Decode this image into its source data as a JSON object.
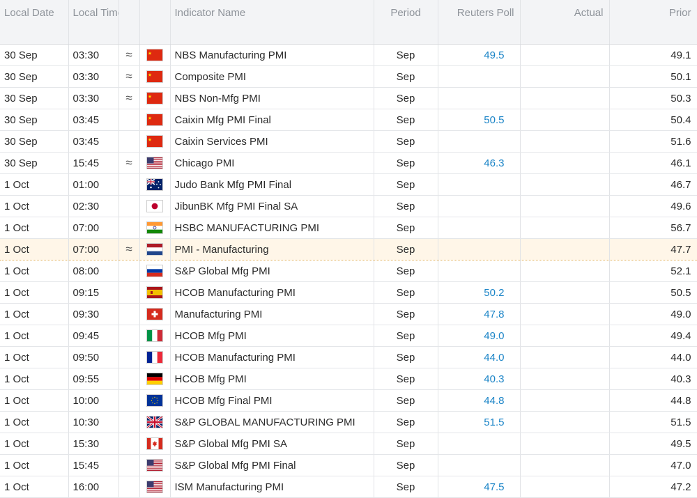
{
  "headers": {
    "local_date": "Local Date",
    "local_time": "Local Time",
    "indicator_name": "Indicator Name",
    "period": "Period",
    "reuters_poll": "Reuters Poll",
    "actual": "Actual",
    "prior": "Prior"
  },
  "rows": [
    {
      "date": "30 Sep",
      "time": "03:30",
      "approx": "≈",
      "flag": "cn",
      "name": "NBS Manufacturing PMI",
      "period": "Sep",
      "poll": "49.5",
      "actual": "",
      "prior": "49.1"
    },
    {
      "date": "30 Sep",
      "time": "03:30",
      "approx": "≈",
      "flag": "cn",
      "name": "Composite PMI",
      "period": "Sep",
      "poll": "",
      "actual": "",
      "prior": "50.1"
    },
    {
      "date": "30 Sep",
      "time": "03:30",
      "approx": "≈",
      "flag": "cn",
      "name": "NBS Non-Mfg PMI",
      "period": "Sep",
      "poll": "",
      "actual": "",
      "prior": "50.3"
    },
    {
      "date": "30 Sep",
      "time": "03:45",
      "approx": "",
      "flag": "cn",
      "name": "Caixin Mfg PMI Final",
      "period": "Sep",
      "poll": "50.5",
      "actual": "",
      "prior": "50.4"
    },
    {
      "date": "30 Sep",
      "time": "03:45",
      "approx": "",
      "flag": "cn",
      "name": "Caixin Services PMI",
      "period": "Sep",
      "poll": "",
      "actual": "",
      "prior": "51.6"
    },
    {
      "date": "30 Sep",
      "time": "15:45",
      "approx": "≈",
      "flag": "us",
      "name": "Chicago PMI",
      "period": "Sep",
      "poll": "46.3",
      "actual": "",
      "prior": "46.1"
    },
    {
      "date": "1 Oct",
      "time": "01:00",
      "approx": "",
      "flag": "au",
      "name": "Judo Bank Mfg PMI Final",
      "period": "Sep",
      "poll": "",
      "actual": "",
      "prior": "46.7"
    },
    {
      "date": "1 Oct",
      "time": "02:30",
      "approx": "",
      "flag": "jp",
      "name": "JibunBK Mfg PMI Final SA",
      "period": "Sep",
      "poll": "",
      "actual": "",
      "prior": "49.6"
    },
    {
      "date": "1 Oct",
      "time": "07:00",
      "approx": "",
      "flag": "in",
      "name": "HSBC MANUFACTURING PMI",
      "period": "Sep",
      "poll": "",
      "actual": "",
      "prior": "56.7"
    },
    {
      "date": "1 Oct",
      "time": "07:00",
      "approx": "≈",
      "flag": "nl",
      "name": "PMI - Manufacturing",
      "period": "Sep",
      "poll": "",
      "actual": "",
      "prior": "47.7",
      "highlight": true
    },
    {
      "date": "1 Oct",
      "time": "08:00",
      "approx": "",
      "flag": "ru",
      "name": "S&P Global Mfg PMI",
      "period": "Sep",
      "poll": "",
      "actual": "",
      "prior": "52.1"
    },
    {
      "date": "1 Oct",
      "time": "09:15",
      "approx": "",
      "flag": "es",
      "name": "HCOB Manufacturing PMI",
      "period": "Sep",
      "poll": "50.2",
      "actual": "",
      "prior": "50.5"
    },
    {
      "date": "1 Oct",
      "time": "09:30",
      "approx": "",
      "flag": "ch",
      "name": "Manufacturing PMI",
      "period": "Sep",
      "poll": "47.8",
      "actual": "",
      "prior": "49.0"
    },
    {
      "date": "1 Oct",
      "time": "09:45",
      "approx": "",
      "flag": "it",
      "name": "HCOB Mfg PMI",
      "period": "Sep",
      "poll": "49.0",
      "actual": "",
      "prior": "49.4"
    },
    {
      "date": "1 Oct",
      "time": "09:50",
      "approx": "",
      "flag": "fr",
      "name": "HCOB Manufacturing PMI",
      "period": "Sep",
      "poll": "44.0",
      "actual": "",
      "prior": "44.0"
    },
    {
      "date": "1 Oct",
      "time": "09:55",
      "approx": "",
      "flag": "de",
      "name": "HCOB Mfg PMI",
      "period": "Sep",
      "poll": "40.3",
      "actual": "",
      "prior": "40.3"
    },
    {
      "date": "1 Oct",
      "time": "10:00",
      "approx": "",
      "flag": "eu",
      "name": "HCOB Mfg Final PMI",
      "period": "Sep",
      "poll": "44.8",
      "actual": "",
      "prior": "44.8"
    },
    {
      "date": "1 Oct",
      "time": "10:30",
      "approx": "",
      "flag": "gb",
      "name": "S&P GLOBAL MANUFACTURING PMI",
      "period": "Sep",
      "poll": "51.5",
      "actual": "",
      "prior": "51.5"
    },
    {
      "date": "1 Oct",
      "time": "15:30",
      "approx": "",
      "flag": "ca",
      "name": "S&P Global Mfg PMI SA",
      "period": "Sep",
      "poll": "",
      "actual": "",
      "prior": "49.5"
    },
    {
      "date": "1 Oct",
      "time": "15:45",
      "approx": "",
      "flag": "us",
      "name": "S&P Global Mfg PMI Final",
      "period": "Sep",
      "poll": "",
      "actual": "",
      "prior": "47.0"
    },
    {
      "date": "1 Oct",
      "time": "16:00",
      "approx": "",
      "flag": "us",
      "name": "ISM Manufacturing PMI",
      "period": "Sep",
      "poll": "47.5",
      "actual": "",
      "prior": "47.2"
    }
  ],
  "colors": {
    "poll_text": "#1a84c7",
    "highlight_row": "#fff6e8",
    "header_bg": "#f3f4f6"
  }
}
